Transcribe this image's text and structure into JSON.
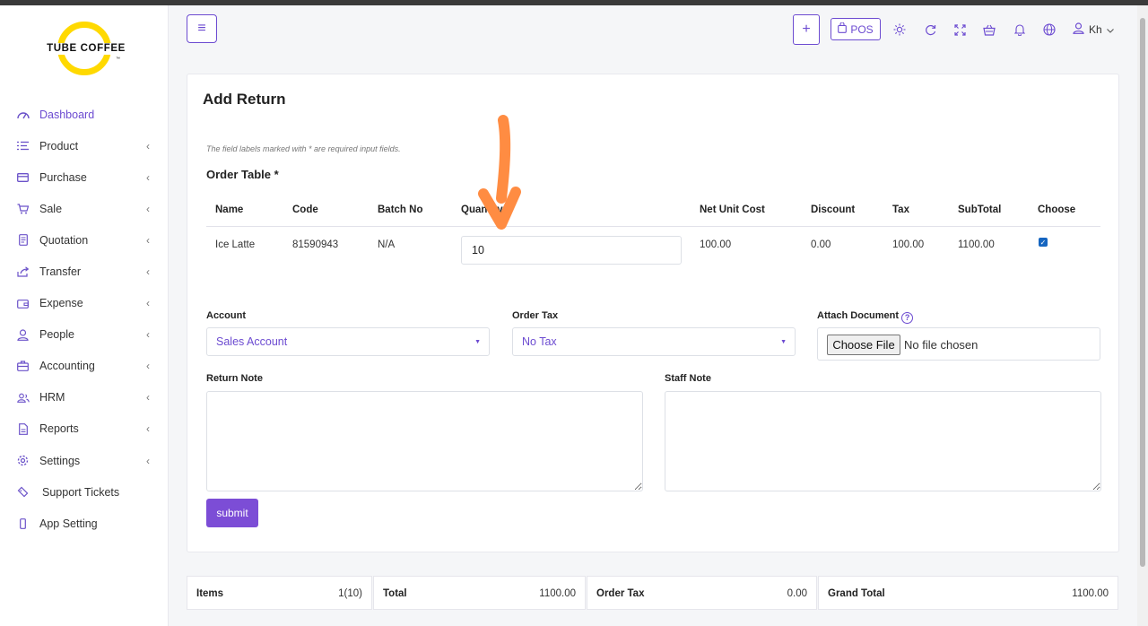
{
  "brand": {
    "name": "TUBE COFFEE",
    "tm": "™"
  },
  "sidebar": {
    "items": [
      {
        "label": "Dashboard",
        "icon": "dashboard-icon"
      },
      {
        "label": "Product",
        "icon": "list-icon"
      },
      {
        "label": "Purchase",
        "icon": "card-icon"
      },
      {
        "label": "Sale",
        "icon": "cart-icon"
      },
      {
        "label": "Quotation",
        "icon": "document-icon"
      },
      {
        "label": "Transfer",
        "icon": "share-icon"
      },
      {
        "label": "Expense",
        "icon": "wallet-icon"
      },
      {
        "label": "People",
        "icon": "user-icon"
      },
      {
        "label": "Accounting",
        "icon": "briefcase-icon"
      },
      {
        "label": "HRM",
        "icon": "users-icon"
      },
      {
        "label": "Reports",
        "icon": "report-icon"
      },
      {
        "label": "Settings",
        "icon": "gear-icon"
      },
      {
        "label": "Support Tickets",
        "icon": "ticket-icon"
      },
      {
        "label": "App Setting",
        "icon": "phone-icon"
      }
    ]
  },
  "topbar": {
    "pos_label": "POS",
    "user_label": "Kh"
  },
  "page": {
    "title": "Add Return",
    "hint": "The field labels marked with * are required input fields.",
    "order_table_title": "Order Table *"
  },
  "order_table": {
    "headers": [
      "Name",
      "Code",
      "Batch No",
      "Quantity",
      "Net Unit Cost",
      "Discount",
      "Tax",
      "SubTotal",
      "Choose"
    ],
    "rows": [
      {
        "name": "Ice Latte",
        "code": "81590943",
        "batch": "N/A",
        "quantity": "10",
        "net_unit_cost": "100.00",
        "discount": "0.00",
        "tax": "100.00",
        "subtotal": "1100.00",
        "choose": true
      }
    ]
  },
  "form": {
    "account_label": "Account",
    "account_value": "Sales Account",
    "order_tax_label": "Order Tax",
    "order_tax_value": "No Tax",
    "attach_label": "Attach Document",
    "choose_file_label": "Choose File",
    "no_file_label": "No file chosen",
    "return_note_label": "Return Note",
    "staff_note_label": "Staff Note",
    "submit_label": "submit"
  },
  "summary": {
    "items_label": "Items",
    "items_value": "1(10)",
    "total_label": "Total",
    "total_value": "1100.00",
    "order_tax_label": "Order Tax",
    "order_tax_value": "0.00",
    "grand_total_label": "Grand Total",
    "grand_total_value": "1100.00"
  },
  "colors": {
    "accent": "#6c4bd1",
    "button": "#7c4dd6",
    "logo_yellow": "#ffd900",
    "annotation_arrow": "#ff8c42"
  }
}
